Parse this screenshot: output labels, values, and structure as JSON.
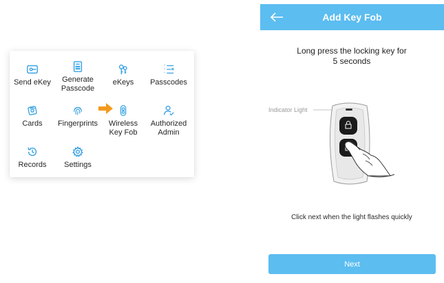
{
  "menu": {
    "items": [
      {
        "label": "Send eKey",
        "icon": "send-ekey-icon"
      },
      {
        "label": "Generate\nPasscode",
        "icon": "generate-passcode-icon"
      },
      {
        "label": "eKeys",
        "icon": "ekeys-icon"
      },
      {
        "label": "Passcodes",
        "icon": "passcodes-icon"
      },
      {
        "label": "Cards",
        "icon": "cards-icon"
      },
      {
        "label": "Fingerprints",
        "icon": "fingerprint-icon"
      },
      {
        "label": "Wireless\nKey Fob",
        "icon": "key-fob-icon"
      },
      {
        "label": "Authorized\nAdmin",
        "icon": "admin-icon"
      },
      {
        "label": "Records",
        "icon": "records-icon"
      },
      {
        "label": "Settings",
        "icon": "settings-icon"
      }
    ]
  },
  "screen": {
    "title": "Add Key Fob",
    "instruction": "Long press the locking key for\n5 seconds",
    "indicator_label": "Indicator Light",
    "hint": "Click next when the light flashes quickly",
    "next_label": "Next"
  },
  "colors": {
    "accent": "#5cbdf0",
    "icon_blue": "#3aa3e3",
    "arrow_orange": "#f39a1e"
  }
}
